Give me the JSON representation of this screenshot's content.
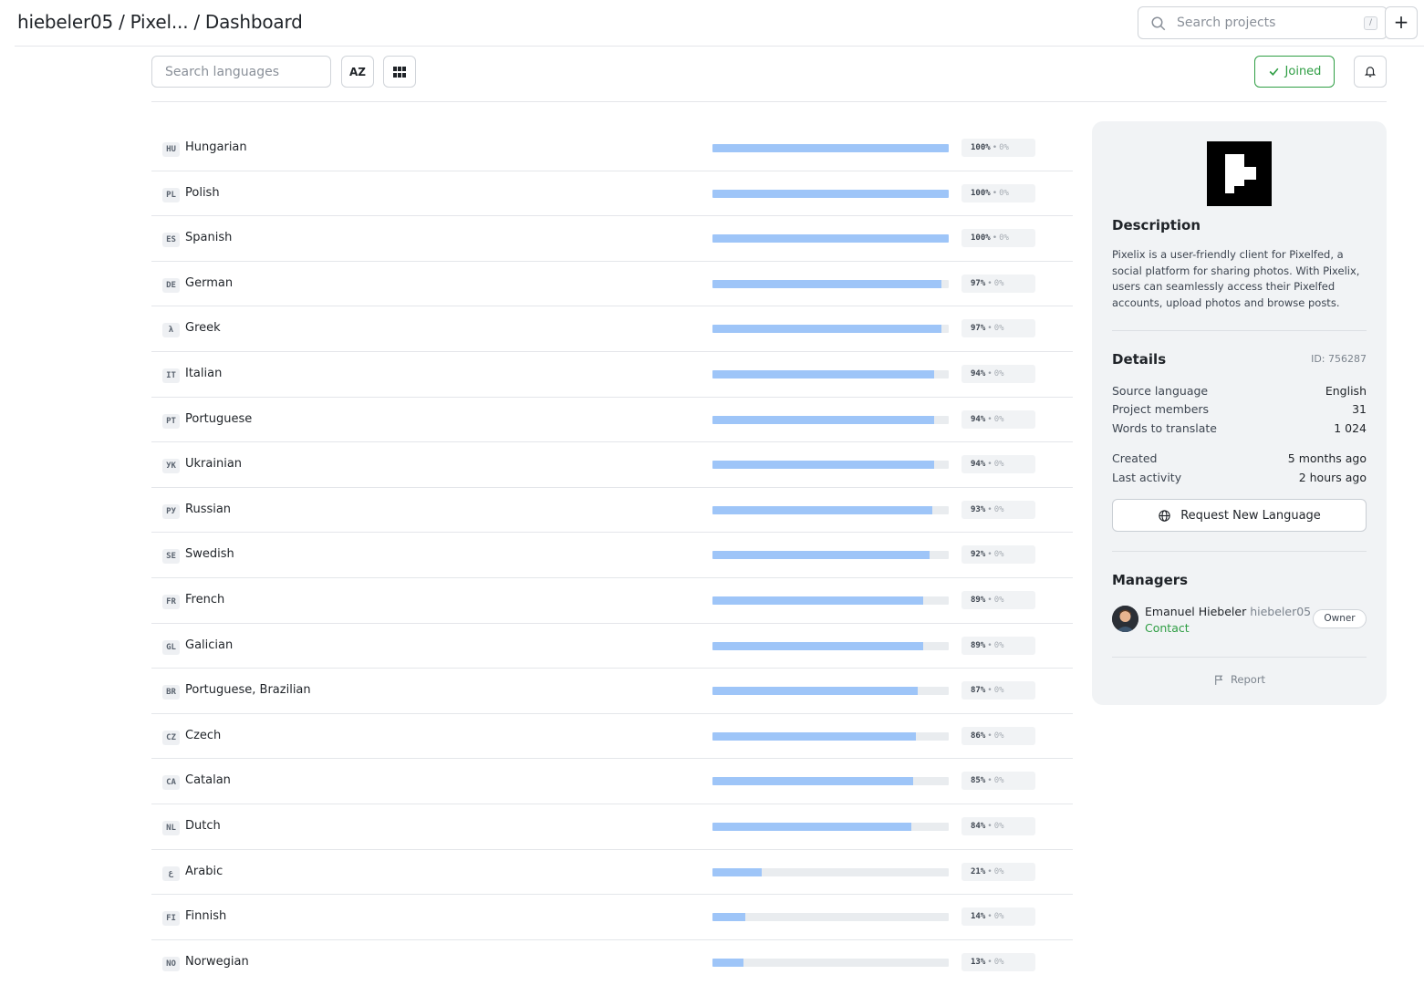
{
  "header": {
    "breadcrumb": [
      "hiebeler05",
      "Pixel...",
      "Dashboard"
    ],
    "search_placeholder": "Search projects",
    "search_shortcut": "/",
    "add_label": "+"
  },
  "toolbar": {
    "search_languages_placeholder": "Search languages",
    "sort_label": "AZ",
    "joined_label": "Joined"
  },
  "languages": [
    {
      "code": "HU",
      "name": "Hungarian",
      "progress": 100,
      "done_label": "100%",
      "review_label": "0%"
    },
    {
      "code": "PL",
      "name": "Polish",
      "progress": 100,
      "done_label": "100%",
      "review_label": "0%"
    },
    {
      "code": "ES",
      "name": "Spanish",
      "progress": 100,
      "done_label": "100%",
      "review_label": "0%"
    },
    {
      "code": "DE",
      "name": "German",
      "progress": 97,
      "done_label": "97%",
      "review_label": "0%"
    },
    {
      "code": "λ",
      "name": "Greek",
      "progress": 97,
      "done_label": "97%",
      "review_label": "0%"
    },
    {
      "code": "IT",
      "name": "Italian",
      "progress": 94,
      "done_label": "94%",
      "review_label": "0%"
    },
    {
      "code": "PT",
      "name": "Portuguese",
      "progress": 94,
      "done_label": "94%",
      "review_label": "0%"
    },
    {
      "code": "УК",
      "name": "Ukrainian",
      "progress": 94,
      "done_label": "94%",
      "review_label": "0%"
    },
    {
      "code": "РУ",
      "name": "Russian",
      "progress": 93,
      "done_label": "93%",
      "review_label": "0%"
    },
    {
      "code": "SE",
      "name": "Swedish",
      "progress": 92,
      "done_label": "92%",
      "review_label": "0%"
    },
    {
      "code": "FR",
      "name": "French",
      "progress": 89,
      "done_label": "89%",
      "review_label": "0%"
    },
    {
      "code": "GL",
      "name": "Galician",
      "progress": 89,
      "done_label": "89%",
      "review_label": "0%"
    },
    {
      "code": "BR",
      "name": "Portuguese, Brazilian",
      "progress": 87,
      "done_label": "87%",
      "review_label": "0%"
    },
    {
      "code": "CZ",
      "name": "Czech",
      "progress": 86,
      "done_label": "86%",
      "review_label": "0%"
    },
    {
      "code": "CA",
      "name": "Catalan",
      "progress": 85,
      "done_label": "85%",
      "review_label": "0%"
    },
    {
      "code": "NL",
      "name": "Dutch",
      "progress": 84,
      "done_label": "84%",
      "review_label": "0%"
    },
    {
      "code": "ع",
      "name": "Arabic",
      "progress": 21,
      "done_label": "21%",
      "review_label": "0%"
    },
    {
      "code": "FI",
      "name": "Finnish",
      "progress": 14,
      "done_label": "14%",
      "review_label": "0%"
    },
    {
      "code": "NO",
      "name": "Norwegian",
      "progress": 13,
      "done_label": "13%",
      "review_label": "0%"
    }
  ],
  "panel": {
    "description_title": "Description",
    "description": "Pixelix is a user-friendly client for Pixelfed, a social platform for sharing photos. With Pixelix, users can seamlessly access their Pixelfed accounts, upload photos and browse posts.",
    "details_title": "Details",
    "project_id": "ID: 756287",
    "details": [
      {
        "key": "Source language",
        "value": "English"
      },
      {
        "key": "Project members",
        "value": "31"
      },
      {
        "key": "Words to translate",
        "value": "1 024"
      },
      {
        "key": "Created",
        "value": "5 months ago"
      },
      {
        "key": "Last activity",
        "value": "2 hours ago"
      }
    ],
    "request_language_label": "Request New Language",
    "managers_title": "Managers",
    "manager": {
      "name": "Emanuel Hiebeler",
      "username": "hiebeler05",
      "contact_label": "Contact",
      "role": "Owner"
    },
    "report_label": "Report"
  },
  "colors": {
    "progress_fill": "#9ec5f8",
    "progress_track": "#e9ecef",
    "accent_green": "#2f9e44",
    "panel_bg": "#f1f3f5"
  },
  "icons": {
    "search": "search-icon",
    "sort": "sort-az-icon",
    "grid": "grid-icon",
    "check": "check-icon",
    "bell": "bell-icon",
    "globe": "globe-icon",
    "flag": "flag-icon"
  }
}
